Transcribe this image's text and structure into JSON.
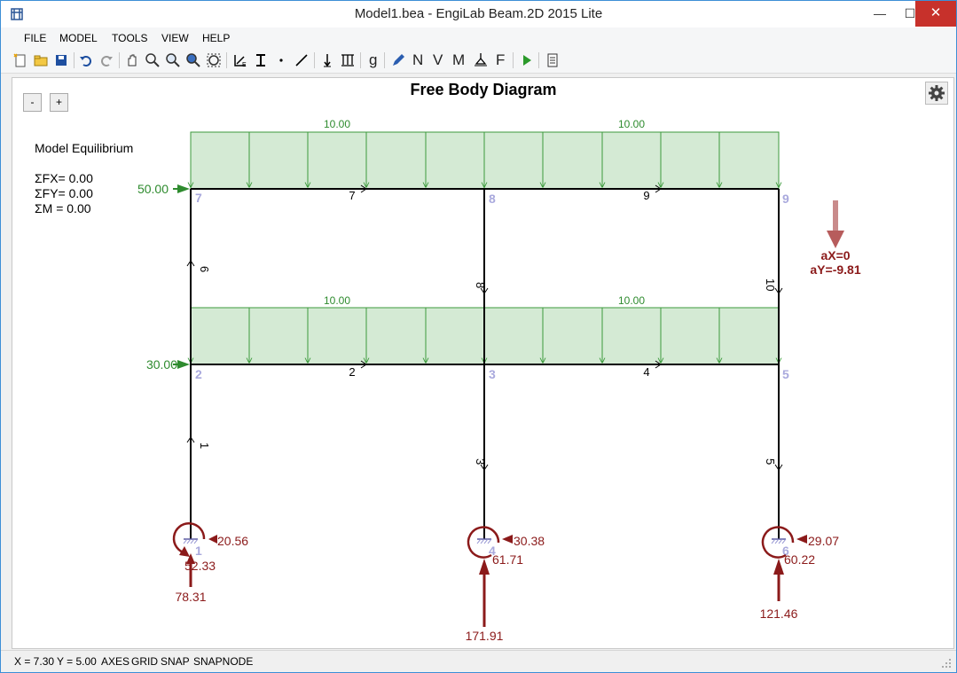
{
  "window": {
    "title": "Model1.bea - EngiLab Beam.2D 2015 Lite",
    "minimize_glyph": "—",
    "maximize_glyph": "☐",
    "close_glyph": "✕"
  },
  "menu": {
    "items": [
      "FILE",
      "MODEL",
      "TOOLS",
      "VIEW",
      "HELP"
    ]
  },
  "toolbar": {
    "icons": [
      "new-file-icon",
      "open-file-icon",
      "save-icon",
      "undo-icon",
      "redo-icon",
      "pan-icon",
      "zoom-window-icon",
      "zoom-in-icon",
      "zoom-out-icon",
      "zoom-extents-icon",
      "material-icon",
      "section-icon",
      "node-icon",
      "element-icon",
      "nodal-load-icon",
      "distributed-load-icon",
      "gravity-icon",
      "normal-force-icon",
      "shear-force-icon",
      "moment-icon",
      "reactions-icon",
      "forces-icon",
      "run-icon",
      "report-icon"
    ],
    "labels": {
      "gravity": "g",
      "normal": "N",
      "shear": "V",
      "moment": "M",
      "force": "F"
    }
  },
  "canvas": {
    "zoom_out_label": "-",
    "zoom_in_label": "+",
    "title": "Free Body Diagram",
    "equilibrium": {
      "heading": "Model Equilibrium",
      "fx": "ΣFX= 0.00",
      "fy": "ΣFY= 0.00",
      "m": "ΣM = 0.00"
    },
    "gravity": {
      "ax": "aX=0",
      "ay": "aY=-9.81"
    },
    "nodes": [
      "1",
      "2",
      "3",
      "4",
      "5",
      "6",
      "7",
      "8",
      "9"
    ],
    "elements": [
      "1",
      "2",
      "3",
      "4",
      "5",
      "6",
      "7",
      "8",
      "9",
      "10"
    ],
    "distributed_loads": [
      "10.00",
      "10.00",
      "10.00",
      "10.00"
    ],
    "nodal_loads": [
      "50.00",
      "30.00"
    ],
    "reactions": {
      "support1": {
        "moment": "20.56",
        "horizontal": "52.33",
        "vertical": "78.31"
      },
      "support4": {
        "moment": "30.38",
        "horizontal": "61.71",
        "vertical": "171.91"
      },
      "support6": {
        "moment": "29.07",
        "horizontal": "60.22",
        "vertical": "121.46"
      }
    },
    "colors": {
      "load_fill": "#d4ead4",
      "load_stroke": "#3c9a3c",
      "load_text": "#2e8b2e",
      "reaction": "#8b1a1a",
      "node_label": "#a9a9dd",
      "frame": "#000000"
    }
  },
  "status": {
    "x": "X = 7.30",
    "y": "Y = 5.00",
    "axes": "AXES",
    "grid": "GRID",
    "snap": "SNAP",
    "snapnode": "SNAPNODE"
  }
}
